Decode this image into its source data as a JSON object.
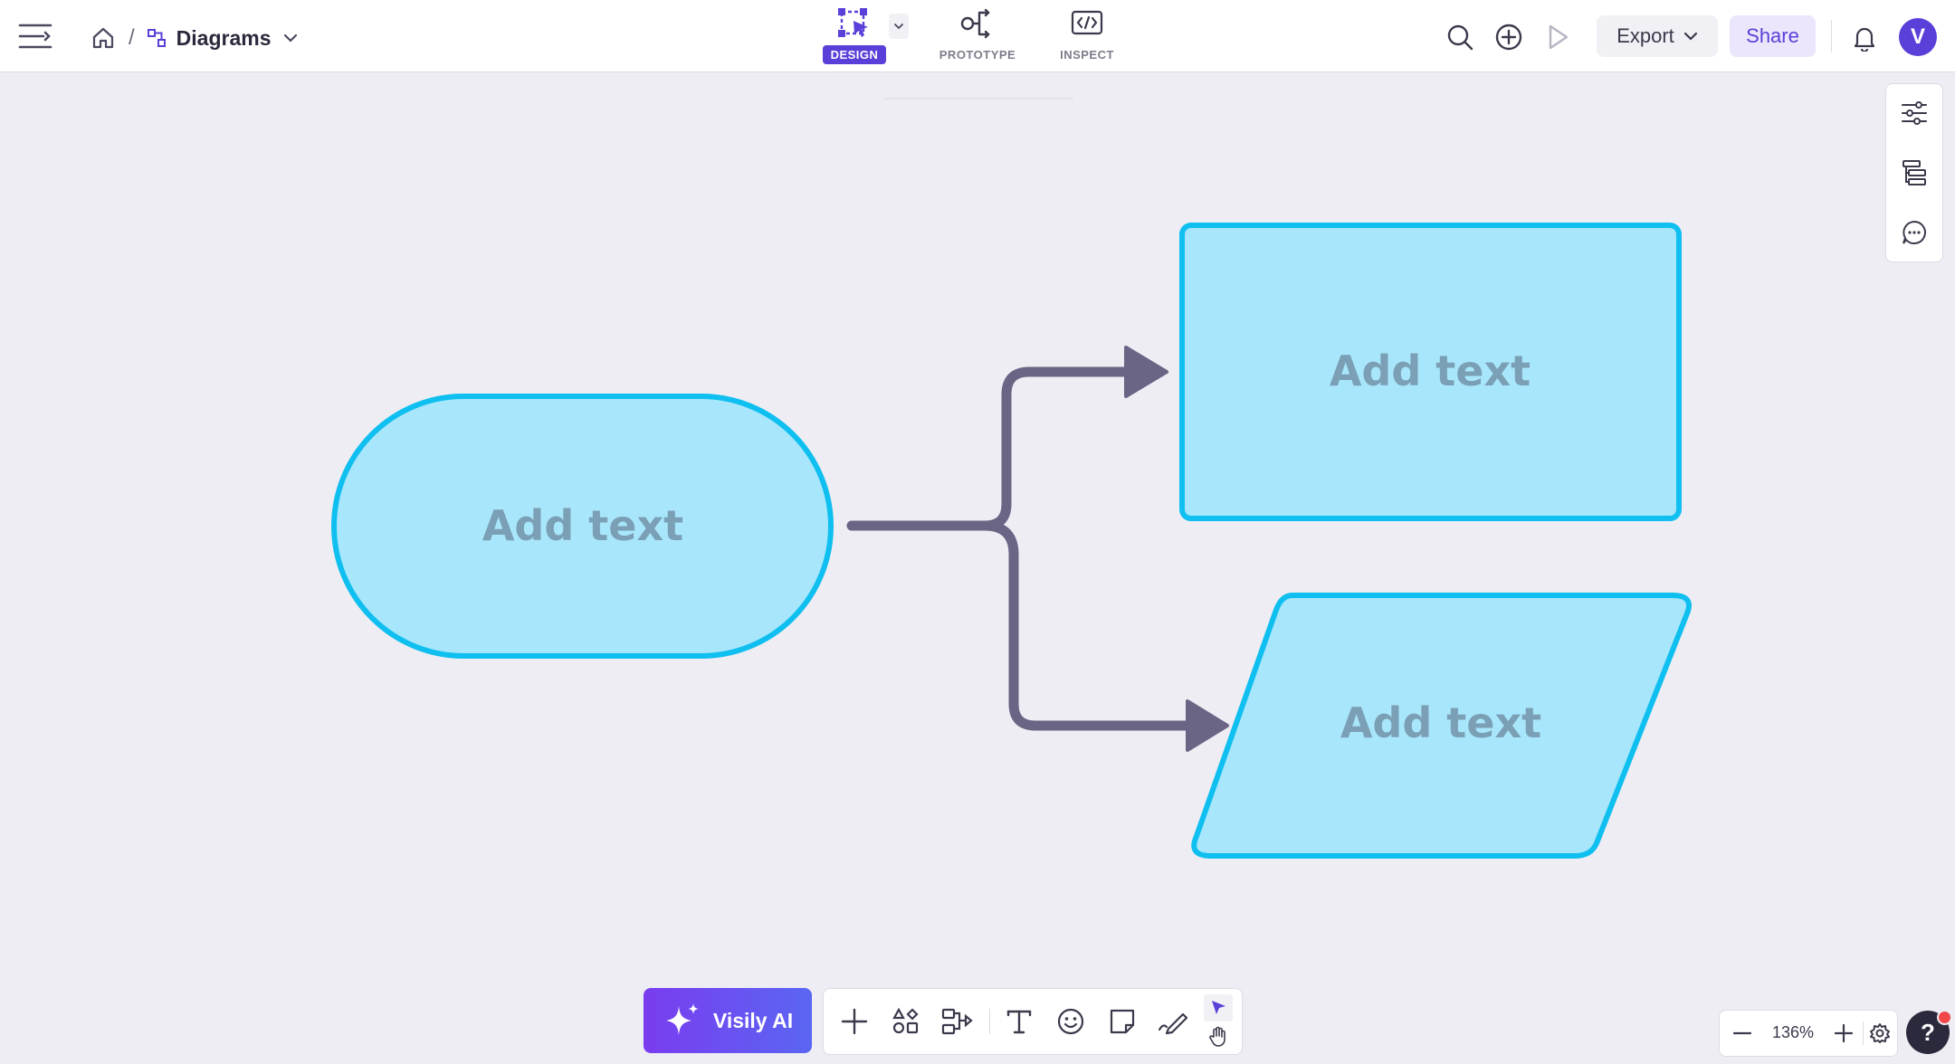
{
  "header": {
    "breadcrumb_title": "Diagrams",
    "breadcrumb_separator": "/",
    "export_label": "Export",
    "share_label": "Share",
    "avatar_initial": "V"
  },
  "mode_tabs": [
    {
      "label": "DESIGN",
      "active": true
    },
    {
      "label": "PROTOTYPE",
      "active": false
    },
    {
      "label": "INSPECT",
      "active": false
    }
  ],
  "canvas": {
    "shapes": [
      {
        "kind": "terminator",
        "text": "Add text"
      },
      {
        "kind": "process",
        "text": "Add text"
      },
      {
        "kind": "data",
        "text": "Add text"
      }
    ],
    "shape_fill": "#a8e6fc",
    "shape_stroke": "#0fbff0",
    "connector_color": "#6a6585"
  },
  "bottom_toolbar": {
    "ai_label": "Visily AI",
    "tools": [
      "plus-icon",
      "shapes-icon",
      "flowchart-icon",
      "text-icon",
      "emoji-icon",
      "sticky-note-icon",
      "pen-icon",
      "select-pointer-icon",
      "hand-icon"
    ]
  },
  "zoom": {
    "level": "136%"
  },
  "help": {
    "label": "?"
  },
  "colors": {
    "accent": "#5b3fd9",
    "canvas_bg": "#eeedf3"
  }
}
